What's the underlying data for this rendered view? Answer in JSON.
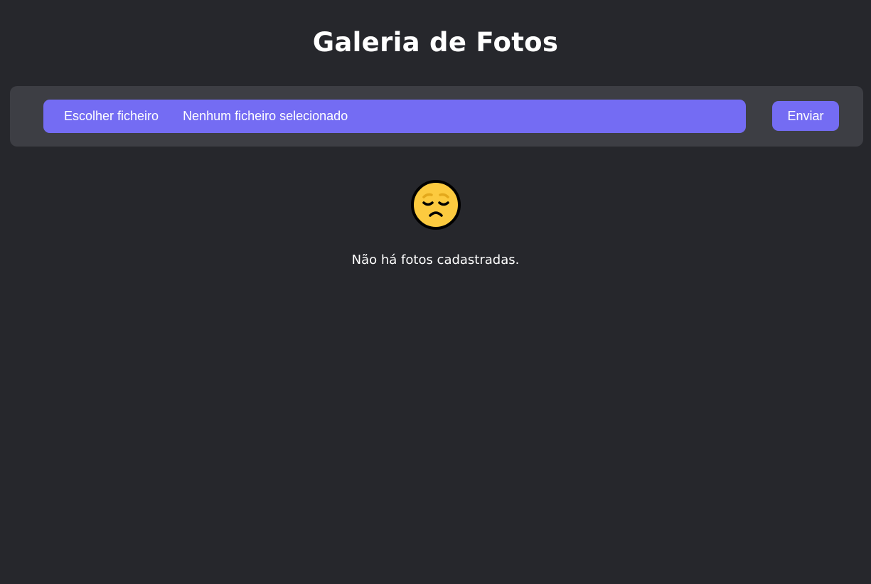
{
  "header": {
    "title": "Galeria de Fotos"
  },
  "upload": {
    "choose_label": "Escolher ficheiro",
    "file_status": "Nenhum ficheiro selecionado",
    "send_label": "Enviar"
  },
  "empty_state": {
    "icon": "sad-face-icon",
    "message": "Não há fotos cadastradas."
  },
  "colors": {
    "background": "#26272c",
    "panel": "#3d3e44",
    "accent": "#746cf3",
    "emoji": "#fcca3f"
  }
}
